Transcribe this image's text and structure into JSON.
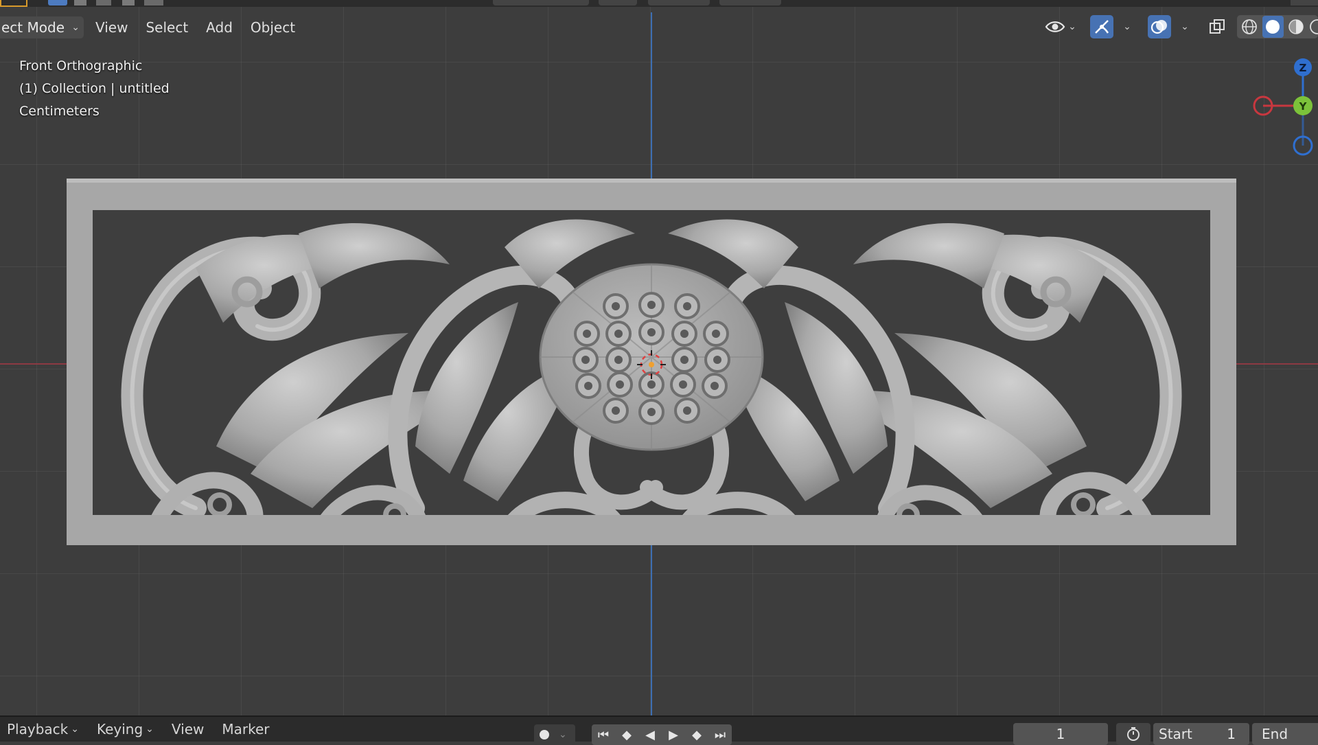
{
  "header": {
    "mode_label": "ect Mode",
    "menus": [
      "View",
      "Select",
      "Add",
      "Object"
    ]
  },
  "overlay": {
    "view_name": "Front Orthographic",
    "collection": "(1) Collection | untitled",
    "units": "Centimeters"
  },
  "gizmo": {
    "z_label": "Z",
    "y_label": "Y"
  },
  "timeline": {
    "playback_label": "Playback",
    "keying_label": "Keying",
    "view_label": "View",
    "marker_label": "Marker",
    "current_frame": "1",
    "start_label": "Start",
    "start_value": "1",
    "end_label": "End"
  },
  "colors": {
    "axis_x": "#9a3a44",
    "axis_z": "#3d6fb2",
    "gizmo_z": "#2f6fd0",
    "gizmo_y": "#7cc23a",
    "gizmo_x": "#c8373f",
    "mesh": "#a8a8a8"
  }
}
